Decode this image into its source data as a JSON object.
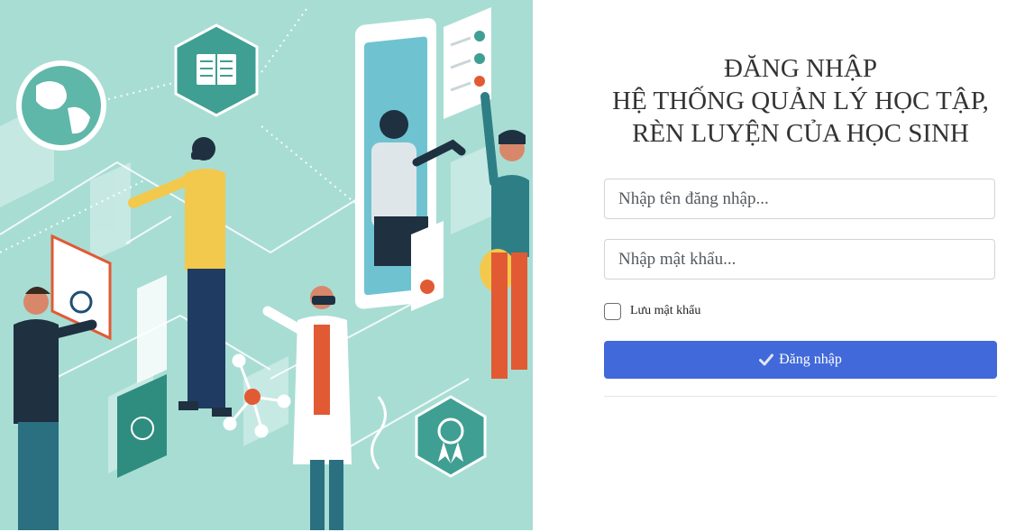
{
  "login": {
    "title_line1": "ĐĂNG NHẬP",
    "title_line2": "HỆ THỐNG QUẢN LÝ HỌC TẬP,",
    "title_line3": "RÈN LUYỆN CỦA HỌC SINH",
    "username_placeholder": "Nhập tên đăng nhập...",
    "password_placeholder": "Nhập mật khẩu...",
    "remember_label": "Lưu mật khẩu",
    "remember_checked": false,
    "submit_label": "Đăng nhập",
    "submit_icon": "check-icon"
  },
  "hero": {
    "illustration": "education-technology-illustration"
  },
  "colors": {
    "hero_background": "#a8ddd4",
    "primary_button": "#4169d9",
    "title_text": "#333333"
  }
}
